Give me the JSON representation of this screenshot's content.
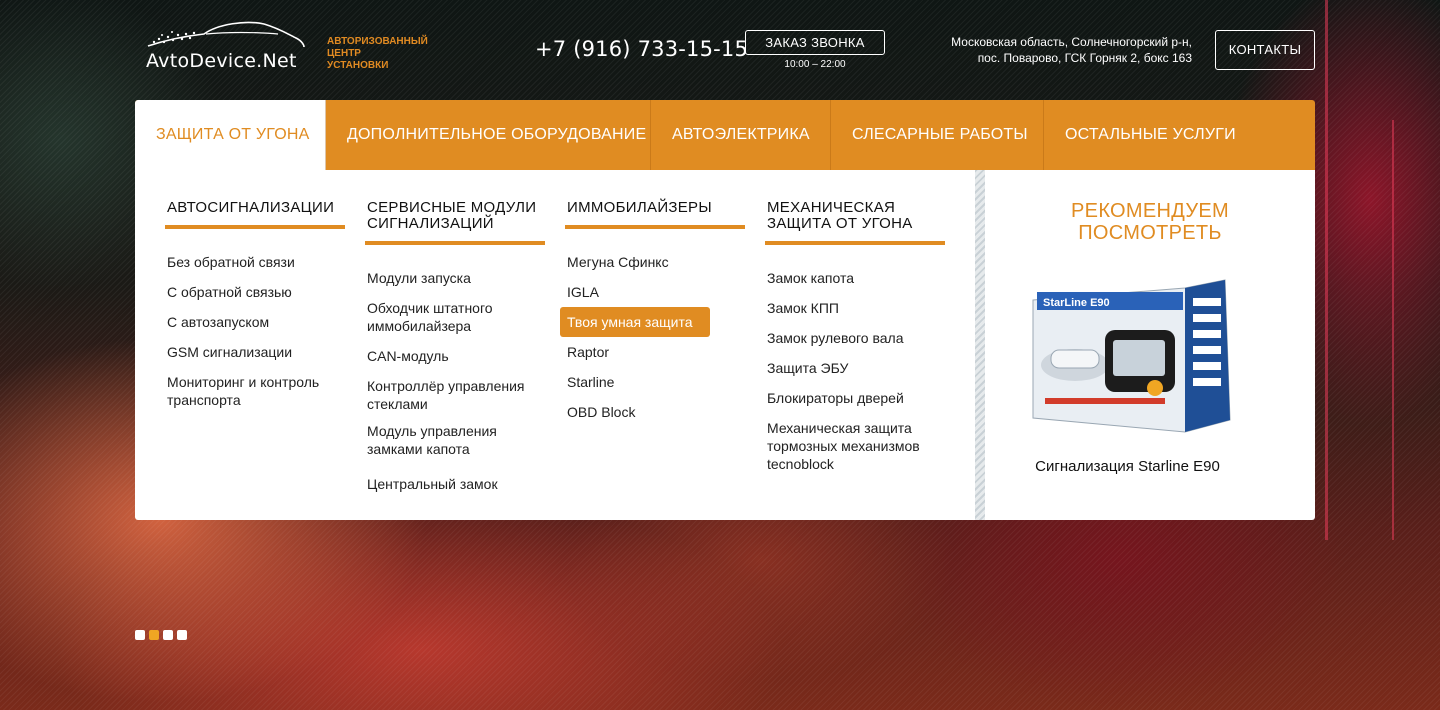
{
  "header": {
    "logo_text": "AvtoDevice.Net",
    "tagline": [
      "АВТОРИЗОВАННЫЙ",
      "ЦЕНТР",
      "УСТАНОВКИ"
    ],
    "phone": "+7 (916) 733-15-15",
    "callback_label": "ЗАКАЗ ЗВОНКА",
    "callback_hours": "10:00 – 22:00",
    "address_line1": "Московская область, Солнечногорский р-н,",
    "address_line2": "пос. Поварово, ГСК Горняк 2, бокс 163",
    "contacts_label": "КОНТАКТЫ"
  },
  "nav": {
    "items": [
      {
        "label": "ЗАЩИТА ОТ УГОНА",
        "active": true
      },
      {
        "label": "ДОПОЛНИТЕЛЬНОЕ ОБОРУДОВАНИЕ"
      },
      {
        "label": "АВТОЭЛЕКТРИКА"
      },
      {
        "label": "СЛЕСАРНЫЕ РАБОТЫ"
      },
      {
        "label": "ОСТАЛЬНЫЕ УСЛУГИ"
      }
    ]
  },
  "dropdown": {
    "columns": [
      {
        "title": "АВТОСИГНАЛИЗАЦИИ",
        "items": [
          "Без обратной связи",
          "С обратной связью",
          "С автозапуском",
          "GSM сигнализации",
          "Мониторинг и контроль транспорта"
        ]
      },
      {
        "title": "СЕРВИСНЫЕ МОДУЛИ СИГНАЛИЗАЦИЙ",
        "items": [
          "Модули запуска",
          "Обходчик штатного иммобилайзера",
          "CAN-модуль",
          "Контроллёр управления стеклами",
          "Модуль управления замками капота",
          "Центральный замок"
        ]
      },
      {
        "title": "ИММОБИЛАЙЗЕРЫ",
        "items": [
          "Мегуна Сфинкс",
          "IGLA",
          "Твоя умная защита",
          "Raptor",
          "Starline",
          "OBD Block"
        ],
        "highlighted": "Твоя умная защита"
      },
      {
        "title": "МЕХАНИЧЕСКАЯ ЗАЩИТА ОТ УГОНА",
        "items": [
          "Замок капота",
          "Замок КПП",
          "Замок рулевого вала",
          "Защита ЭБУ",
          "Блокираторы дверей",
          "Механическая защита тормозных механизмов tecnoblock"
        ]
      }
    ],
    "recommend": {
      "title_line1": "РЕКОМЕНДУЕМ",
      "title_line2": "ПОСМОТРЕТЬ",
      "box_brand": "StarLine E90",
      "product_name": "Сигнализация Starline E90"
    }
  },
  "slider": {
    "dots": 4,
    "active_index": 1
  },
  "colors": {
    "accent": "#e08c22",
    "white": "#ffffff",
    "text": "#222222"
  }
}
